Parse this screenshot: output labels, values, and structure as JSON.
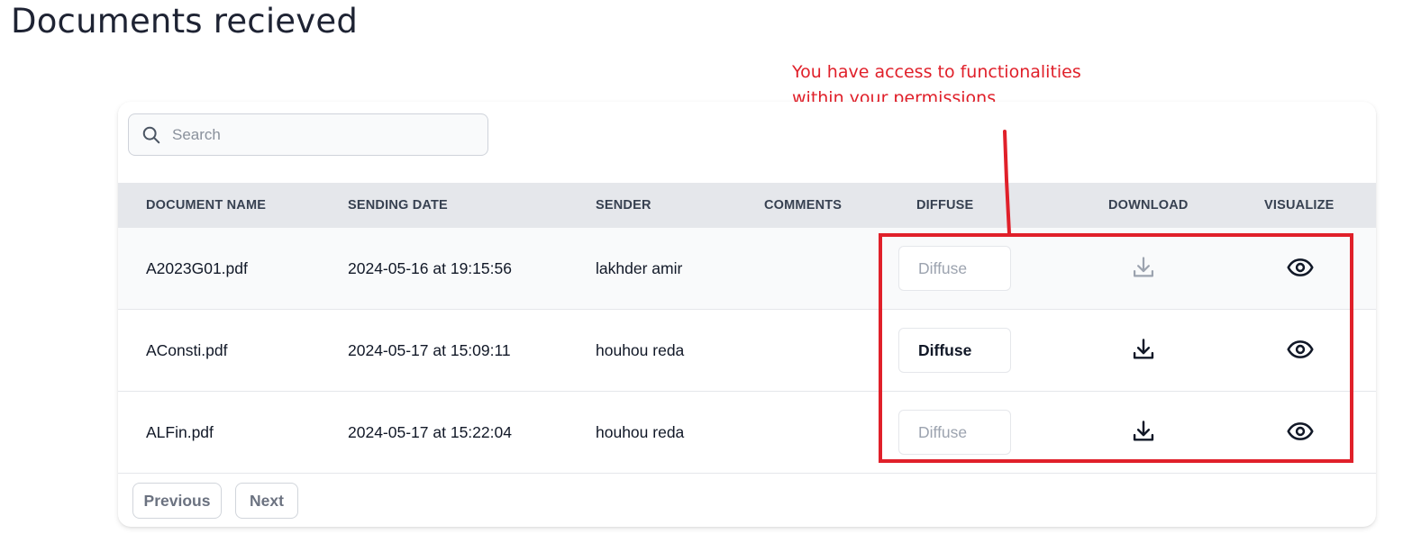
{
  "page": {
    "title": "Documents recieved"
  },
  "annotation": {
    "line1": "You have access to functionalities",
    "line2": "within your permissions",
    "color": "#e0202a"
  },
  "search": {
    "placeholder": "Search",
    "value": "",
    "icon": "search-icon"
  },
  "table": {
    "headers": {
      "document_name": "DOCUMENT NAME",
      "sending_date": "SENDING DATE",
      "sender": "SENDER",
      "comments": "COMMENTS",
      "diffuse": "DIFFUSE",
      "download": "DOWNLOAD",
      "visualize": "VISUALIZE"
    },
    "rows": [
      {
        "document_name": "A2023G01.pdf",
        "sending_date": "2024-05-16 at 19:15:56",
        "sender": "lakhder amir",
        "comments": "",
        "diffuse_label": "Diffuse",
        "diffuse_enabled": false,
        "download_enabled": false,
        "download_icon": "download-icon",
        "visualize_icon": "eye-icon"
      },
      {
        "document_name": "AConsti.pdf",
        "sending_date": "2024-05-17 at 15:09:11",
        "sender": "houhou reda",
        "comments": "",
        "diffuse_label": "Diffuse",
        "diffuse_enabled": true,
        "download_enabled": true,
        "download_icon": "download-icon",
        "visualize_icon": "eye-icon"
      },
      {
        "document_name": "ALFin.pdf",
        "sending_date": "2024-05-17 at 15:22:04",
        "sender": "houhou reda",
        "comments": "",
        "diffuse_label": "Diffuse",
        "diffuse_enabled": false,
        "download_enabled": true,
        "download_icon": "download-icon",
        "visualize_icon": "eye-icon"
      }
    ]
  },
  "pagination": {
    "previous_label": "Previous",
    "next_label": "Next"
  }
}
